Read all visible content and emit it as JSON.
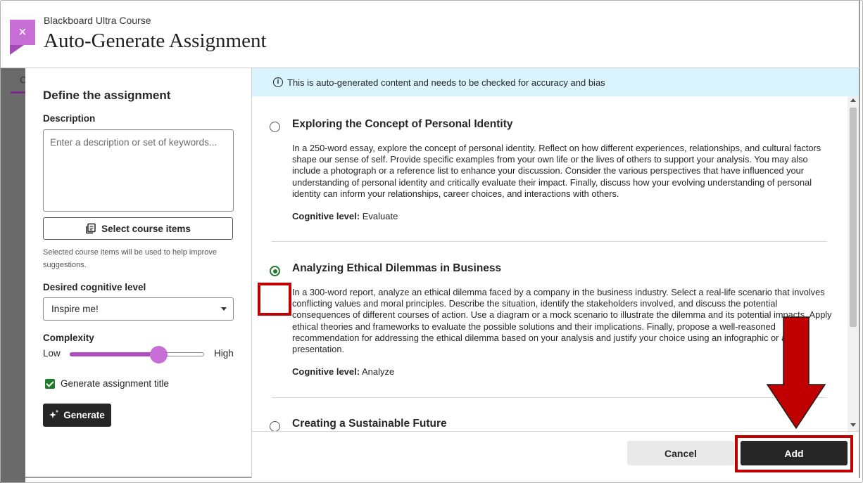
{
  "background": {
    "tab_letter": "C"
  },
  "header": {
    "close_icon": "×",
    "kicker": "Blackboard Ultra Course",
    "title": "Auto-Generate Assignment"
  },
  "left": {
    "section_title": "Define the assignment",
    "description_label": "Description",
    "description_placeholder": "Enter a description or set of keywords...",
    "select_items_label": "Select course items",
    "hint": "Selected course items will be used to help improve suggestions.",
    "cognitive_label": "Desired cognitive level",
    "cognitive_value": "Inspire me!",
    "complexity_label": "Complexity",
    "complexity_low": "Low",
    "complexity_high": "High",
    "complexity_level": 0.66,
    "generate_title_label": "Generate assignment title",
    "generate_title_checked": true,
    "generate_button": "Generate"
  },
  "notice": {
    "text": "This is auto-generated content and needs to be checked for accuracy and bias"
  },
  "suggestions": [
    {
      "title": "Exploring the Concept of Personal Identity",
      "body": "In a 250-word essay, explore the concept of personal identity. Reflect on how different experiences, relationships, and cultural factors shape our sense of self. Provide specific examples from your own life or the lives of others to support your analysis. You may also include a photograph or a reference list to enhance your discussion. Consider the various perspectives that have influenced your understanding of personal identity and critically evaluate their impact. Finally, discuss how your evolving understanding of personal identity can inform your relationships, career choices, and interactions with others.",
      "level_label": "Cognitive level:",
      "level_value": "Evaluate",
      "selected": false
    },
    {
      "title": "Analyzing Ethical Dilemmas in Business",
      "body": "In a 300-word report, analyze an ethical dilemma faced by a company in the business industry. Select a real-life scenario that involves conflicting values and moral principles. Describe the situation, identify the stakeholders involved, and discuss the potential consequences of different courses of action. Use a diagram or a mock scenario to illustrate the dilemma and its potential impacts. Apply ethical theories and frameworks to evaluate the possible solutions and their implications. Finally, propose a well-reasoned recommendation for addressing the ethical dilemma based on your analysis and justify your choice using an infographic or a presentation.",
      "level_label": "Cognitive level:",
      "level_value": "Analyze",
      "selected": true
    },
    {
      "title": "Creating a Sustainable Future",
      "selected": false
    }
  ],
  "footer": {
    "cancel": "Cancel",
    "add": "Add"
  },
  "colors": {
    "accent": "#c86ed7",
    "highlight": "#c00000",
    "notice_bg": "#d9f4fc",
    "check_green": "#1e7d2b"
  }
}
